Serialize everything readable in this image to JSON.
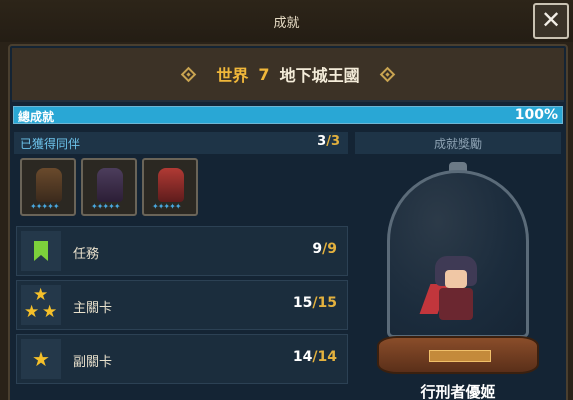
{
  "header": {
    "title": "成就",
    "close_symbol": "✕"
  },
  "world": {
    "label": "世界",
    "number": "7",
    "name": "地下城王國"
  },
  "total": {
    "label": "總成就",
    "percent_text": "100%",
    "progress": 1.0
  },
  "companions": {
    "title": "已獲得同伴",
    "count": "3",
    "total": "/3",
    "portraits": [
      {
        "icon": "armored-knight-sprite",
        "stars": "✦✦✦✦✦"
      },
      {
        "icon": "dark-mage-sprite",
        "stars": "✦✦✦✦✦"
      },
      {
        "icon": "red-hair-warrior-sprite",
        "stars": "✦✦✦✦✦"
      }
    ]
  },
  "achievements": [
    {
      "icon": "bookmark-icon",
      "label": "任務",
      "value": "9",
      "total": "/9"
    },
    {
      "icon": "three-stars-icon",
      "label": "主關卡",
      "value": "15",
      "total": "/15"
    },
    {
      "icon": "star-icon",
      "label": "副關卡",
      "value": "14",
      "total": "/14"
    }
  ],
  "reward": {
    "title": "成就獎勵",
    "name": "行刑者優姬"
  },
  "colors": {
    "accent_gold": "#f0b73a",
    "progress_blue": "#29a7d5",
    "bookmark_green": "#7cd13b",
    "star_yellow": "#f5c02a"
  }
}
